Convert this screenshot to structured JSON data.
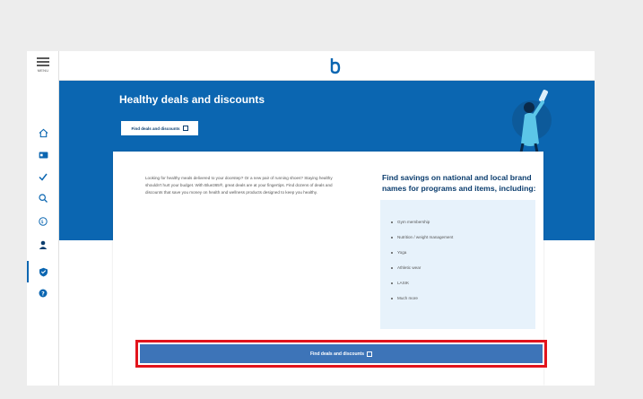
{
  "rail": {
    "menu_label": "MENU",
    "items": [
      {
        "icon": "home-icon"
      },
      {
        "icon": "id-card-icon"
      },
      {
        "icon": "checkmark-icon"
      },
      {
        "icon": "search-icon"
      },
      {
        "icon": "benefits-icon"
      },
      {
        "icon": "person-icon"
      },
      {
        "icon": "health-shield-icon"
      },
      {
        "icon": "help-icon"
      }
    ],
    "active_item": "health-shield-icon"
  },
  "header": {
    "logo": "b"
  },
  "banner": {
    "title": "Healthy deals and discounts",
    "button_label": "Find deals and discounts"
  },
  "card": {
    "description": "Looking for healthy meals delivered to your doorstep? Or a new pair of running shoes? Staying healthy shouldn't hurt your budget. With Blue365®, great deals are at your fingertips. Find dozens of deals and discounts that save you money on health and wellness products designed to keep you healthy.",
    "savings_title": "Find savings on national and local brand names for programs and items, including:",
    "items": [
      "Gym membership",
      "Nutrition / weight management",
      "Yoga",
      "Athletic wear",
      "LASIK",
      "Much more"
    ],
    "cta_label": "Find deals and discounts"
  },
  "colors": {
    "brand_blue": "#0b66b1",
    "cta_blue": "#3d74b8",
    "highlight_red": "#e2141c",
    "list_bg": "#e7f2fb"
  }
}
